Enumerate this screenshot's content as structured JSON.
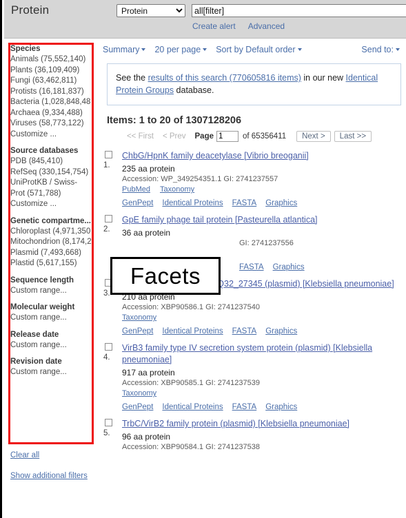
{
  "header": {
    "db_title": "Protein",
    "db_select_value": "Protein",
    "db_select_options": [
      "Protein"
    ],
    "search_value": "all[filter]",
    "search_placeholder": "",
    "create_alert": "Create alert",
    "advanced": "Advanced"
  },
  "sidebar": {
    "groups": [
      {
        "title": "Species",
        "items": [
          "Animals (75,552,140)",
          "Plants (36,109,409)",
          "Fungi (63,462,811)",
          "Protists (16,181,837)",
          "Bacteria (1,028,848,48",
          "Archaea (9,334,488)",
          "Viruses (58,773,122)",
          "Customize ..."
        ]
      },
      {
        "title": "Source databases",
        "items": [
          "PDB (845,410)",
          "RefSeq (330,154,754)",
          "UniProtKB / Swiss-Prot (571,788)",
          "Customize ..."
        ]
      },
      {
        "title": "Genetic compartme...",
        "items": [
          "Chloroplast (4,971,350",
          "Mitochondrion (8,174,2",
          "Plasmid (7,493,668)",
          "Plastid (5,617,155)"
        ]
      },
      {
        "title": "Sequence length",
        "items": [
          "Custom range..."
        ]
      },
      {
        "title": "Molecular weight",
        "items": [
          "Custom range..."
        ]
      },
      {
        "title": "Release date",
        "items": [
          "Custom range..."
        ]
      },
      {
        "title": "Revision date",
        "items": [
          "Custom range..."
        ]
      }
    ],
    "clear_all": "Clear all",
    "show_additional_filters": "Show additional filters"
  },
  "toolbar": {
    "display": "Summary",
    "per_page": "20 per page",
    "sort": "Sort by Default order",
    "send_to": "Send to:"
  },
  "notice": {
    "prefix": "See the ",
    "link1": "results of this search (770605816 items)",
    "middle": " in our new ",
    "link2": "Identical Protein Groups",
    "suffix": " database."
  },
  "results_header": "Items: 1 to 20 of 1307128206",
  "pager": {
    "first": "<< First",
    "prev": "< Prev",
    "page_label": "Page",
    "page_value": "1",
    "of_total": "of 65356411",
    "next": "Next >",
    "last": "Last >>"
  },
  "callout": {
    "label": "Facets"
  },
  "results": [
    {
      "num": "1.",
      "title": "ChbG/HpnK family deacetylase [Vibrio breoganii]",
      "length": "235 aa protein",
      "accession": "Accession: WP_349254351.1   GI: 2741237557",
      "sublinks": [
        "PubMed",
        "Taxonomy"
      ],
      "links": [
        "GenPept",
        "Identical Proteins",
        "FASTA",
        "Graphics"
      ]
    },
    {
      "num": "2.",
      "title": "GpE family phage tail protein [Pasteurella atlantica]",
      "length": "36 aa protein",
      "accession": "GI: 2741237556",
      "sublinks": [],
      "links": [
        "FASTA",
        "Graphics"
      ]
    },
    {
      "num": "3.",
      "title": "hypothetical protein ABMQ32_27345 (plasmid) [Klebsiella pneumoniae]",
      "length": "210 aa protein",
      "accession": "Accession: XBP90586.1   GI: 2741237540",
      "sublinks": [
        "Taxonomy"
      ],
      "links": [
        "GenPept",
        "Identical Proteins",
        "FASTA",
        "Graphics"
      ]
    },
    {
      "num": "4.",
      "title": "VirB3 family type IV secretion system protein (plasmid) [Klebsiella pneumoniae]",
      "length": "917 aa protein",
      "accession": "Accession: XBP90585.1   GI: 2741237539",
      "sublinks": [
        "Taxonomy"
      ],
      "links": [
        "GenPept",
        "Identical Proteins",
        "FASTA",
        "Graphics"
      ]
    },
    {
      "num": "5.",
      "title": "TrbC/VirB2 family protein (plasmid) [Klebsiella pneumoniae]",
      "length": "96 aa protein",
      "accession": "Accession: XBP90584.1   GI: 2741237538",
      "sublinks": [],
      "links": []
    }
  ],
  "colors": {
    "facet_highlight": "#ee1111",
    "link": "#4a6ea9",
    "header_bg": "#d6d6d6"
  }
}
